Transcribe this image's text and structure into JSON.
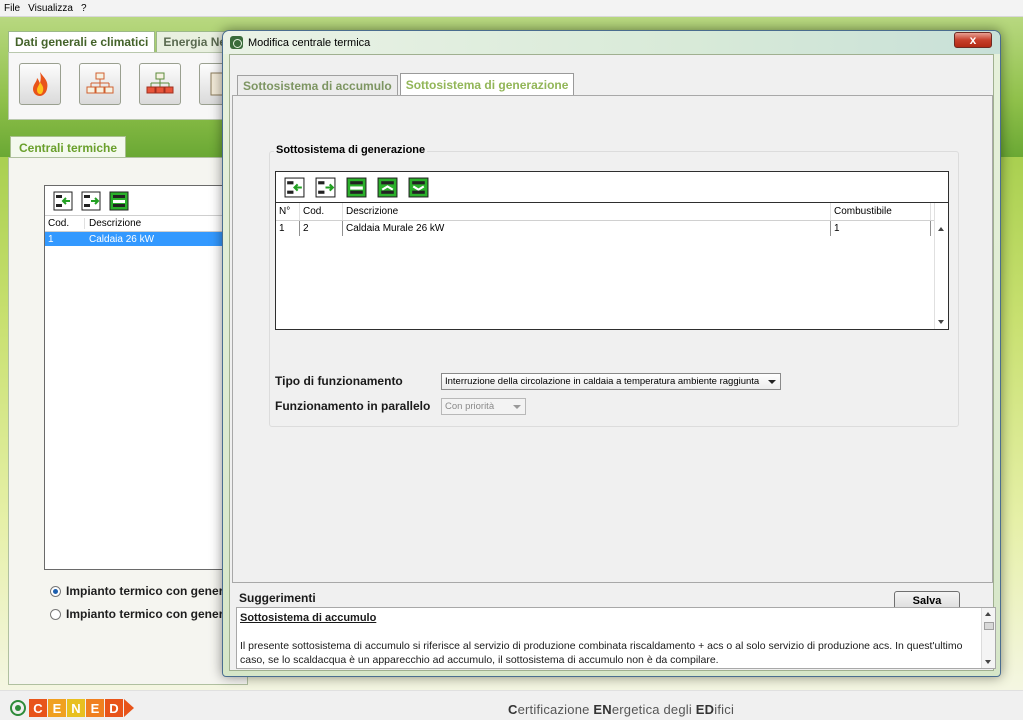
{
  "menu": {
    "items": [
      "File",
      "Visualizza",
      "?"
    ]
  },
  "main_tabs": [
    "Dati generali e climatici",
    "Energia Nett"
  ],
  "toolbar": {
    "icons": [
      "flame-icon",
      "plant-diagram-icon",
      "network-diagram-icon",
      "document-icon"
    ]
  },
  "centrali": {
    "tab_label": "Centrali termiche",
    "columns": [
      "Cod.",
      "Descrizione"
    ],
    "rows": [
      {
        "cod": "1",
        "descr": "Caldaia 26 kW"
      }
    ]
  },
  "radios": [
    {
      "label": "Impianto termico con genera",
      "checked": true
    },
    {
      "label": "Impianto termico con genera",
      "checked": false
    }
  ],
  "dialog": {
    "title": "Modifica centrale termica",
    "close_label": "x",
    "tabs": [
      "Sottosistema di accumulo",
      "Sottosistema di generazione"
    ],
    "active_tab": "Sottosistema di generazione",
    "group_title": "Sottosistema di generazione",
    "table": {
      "columns": [
        "N°",
        "Cod.",
        "Descrizione",
        "Combustibile"
      ],
      "rows": [
        {
          "n": "1",
          "cod": "2",
          "descr": "Caldaia Murale 26 kW",
          "comb": "1"
        }
      ]
    },
    "tipo_label": "Tipo di funzionamento",
    "tipo_value": "Interruzione della circolazione in caldaia a temperatura ambiente raggiunta",
    "parallelo_label": "Funzionamento in parallelo",
    "parallelo_value": "Con priorità",
    "save_label": "Salva",
    "suggestions": {
      "title": "Suggerimenti",
      "heading": "Sottosistema di accumulo",
      "text": "Il presente sottosistema di accumulo si riferisce al servizio di produzione combinata riscaldamento + acs o al solo servizio di produzione acs. In quest'ultimo caso, se lo scaldacqua è un apparecchio ad accumulo, il sottosistema di accumulo non è da compilare."
    }
  },
  "footer": {
    "logo_letters": [
      "C",
      "E",
      "N",
      "E",
      "D"
    ],
    "tagline": [
      {
        "b": "C",
        "r": "ertificazione "
      },
      {
        "b": "EN",
        "r": "ergetica degli "
      },
      {
        "b": "ED",
        "r": "ifici"
      }
    ]
  },
  "colors": {
    "accent_green": "#92b658",
    "selection_blue": "#3399ff",
    "logo_green": "#2e8b3a",
    "logo_orange": "#e8541a"
  }
}
